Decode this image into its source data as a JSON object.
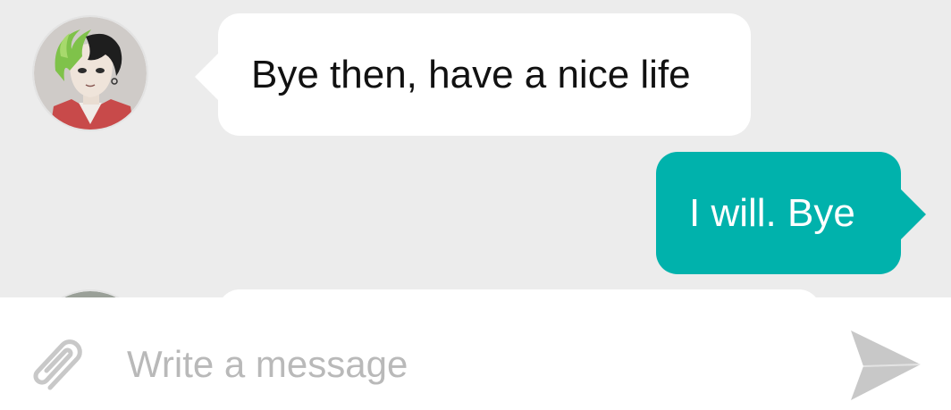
{
  "messages": [
    {
      "direction": "incoming",
      "text": "Bye then, have a nice life",
      "avatar": "anime-character-avatar"
    },
    {
      "direction": "outgoing",
      "text": "I will. Bye"
    },
    {
      "direction": "incoming",
      "text": "",
      "avatar": "anime-character-avatar"
    }
  ],
  "composer": {
    "placeholder": "Write a message",
    "value": "",
    "attach_icon": "paperclip-icon",
    "send_icon": "send-icon"
  },
  "colors": {
    "background": "#ececec",
    "incoming_bubble": "#ffffff",
    "outgoing_bubble": "#00b2ac",
    "composer_background": "#ffffff",
    "icon_gray": "#c8c8c8"
  }
}
